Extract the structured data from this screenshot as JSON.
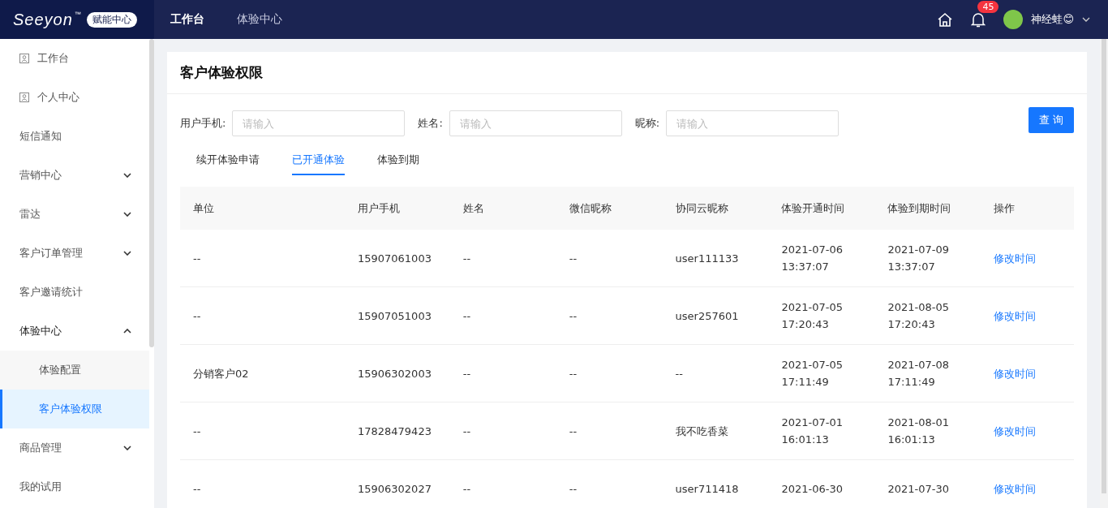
{
  "header": {
    "logo": "Seeyon",
    "logo_mark": "™",
    "badge": "赋能中心",
    "nav": [
      {
        "label": "工作台",
        "selected": true
      },
      {
        "label": "体验中心",
        "selected": false
      }
    ],
    "notification_count": "45",
    "user_name": "神经蛙😊"
  },
  "sidebar": {
    "items": [
      {
        "label": "工作台",
        "kind": "icon",
        "selected": false
      },
      {
        "label": "个人中心",
        "kind": "icon",
        "selected": false
      },
      {
        "label": "短信通知",
        "kind": "plain",
        "selected": false
      },
      {
        "label": "营销中心",
        "kind": "group",
        "expanded": false
      },
      {
        "label": "雷达",
        "kind": "group",
        "expanded": false
      },
      {
        "label": "客户订单管理",
        "kind": "group",
        "expanded": false
      },
      {
        "label": "客户邀请统计",
        "kind": "plain",
        "selected": false
      },
      {
        "label": "体验中心",
        "kind": "group",
        "expanded": true,
        "children": [
          {
            "label": "体验配置",
            "selected": false
          },
          {
            "label": "客户体验权限",
            "selected": true
          }
        ]
      },
      {
        "label": "商品管理",
        "kind": "group",
        "expanded": false
      },
      {
        "label": "我的试用",
        "kind": "plain",
        "selected": false
      }
    ]
  },
  "page": {
    "title": "客户体验权限",
    "filters": [
      {
        "label": "用户手机:",
        "placeholder": "请输入"
      },
      {
        "label": "姓名:",
        "placeholder": "请输入"
      },
      {
        "label": "昵称:",
        "placeholder": "请输入"
      }
    ],
    "search_button": "查 询",
    "tabs": [
      {
        "label": "续开体验申请",
        "selected": false
      },
      {
        "label": "已开通体验",
        "selected": true
      },
      {
        "label": "体验到期",
        "selected": false
      }
    ],
    "table": {
      "columns": [
        "单位",
        "用户手机",
        "姓名",
        "微信昵称",
        "协同云昵称",
        "体验开通时间",
        "体验到期时间",
        "操作"
      ],
      "rows": [
        {
          "cells": [
            "--",
            "15907061003",
            "--",
            "--",
            "user111133",
            [
              "2021-07-06",
              "13:37:07"
            ],
            [
              "2021-07-09",
              "13:37:07"
            ]
          ],
          "action": "修改时间"
        },
        {
          "cells": [
            "--",
            "15907051003",
            "--",
            "--",
            "user257601",
            [
              "2021-07-05",
              "17:20:43"
            ],
            [
              "2021-08-05",
              "17:20:43"
            ]
          ],
          "action": "修改时间"
        },
        {
          "cells": [
            "分销客户02",
            "15906302003",
            "--",
            "--",
            "--",
            [
              "2021-07-05",
              "17:11:49"
            ],
            [
              "2021-07-08",
              "17:11:49"
            ]
          ],
          "action": "修改时间"
        },
        {
          "cells": [
            "--",
            "17828479423",
            "--",
            "--",
            "我不吃香菜",
            [
              "2021-07-01",
              "16:01:13"
            ],
            [
              "2021-08-01",
              "16:01:13"
            ]
          ],
          "action": "修改时间"
        },
        {
          "cells": [
            "--",
            "15906302027",
            "--",
            "--",
            "user711418",
            [
              "2021-06-30"
            ],
            [
              "2021-07-30"
            ]
          ],
          "action": "修改时间"
        }
      ]
    }
  }
}
